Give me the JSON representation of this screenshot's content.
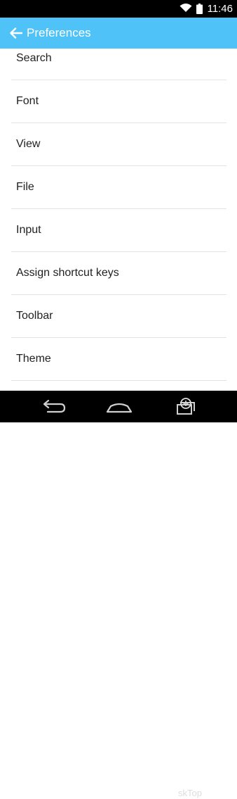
{
  "status_bar": {
    "time": "11:46"
  },
  "action_bar": {
    "title": "Preferences"
  },
  "preferences": {
    "items": [
      {
        "label": "Search"
      },
      {
        "label": "Font"
      },
      {
        "label": "View"
      },
      {
        "label": "File"
      },
      {
        "label": "Input"
      },
      {
        "label": "Assign shortcut keys"
      },
      {
        "label": "Toolbar"
      },
      {
        "label": "Theme"
      }
    ]
  },
  "watermark": {
    "text": "skTop"
  },
  "colors": {
    "accent": "#4fc3f7",
    "status_bar": "#000000",
    "nav_bar": "#000000",
    "divider": "#e3e3e3"
  },
  "icons": {
    "status": [
      "wifi-icon",
      "battery-icon"
    ],
    "nav": [
      "back-nav-icon",
      "home-nav-icon",
      "recents-nav-icon"
    ],
    "action_bar": [
      "back-arrow-icon"
    ]
  }
}
